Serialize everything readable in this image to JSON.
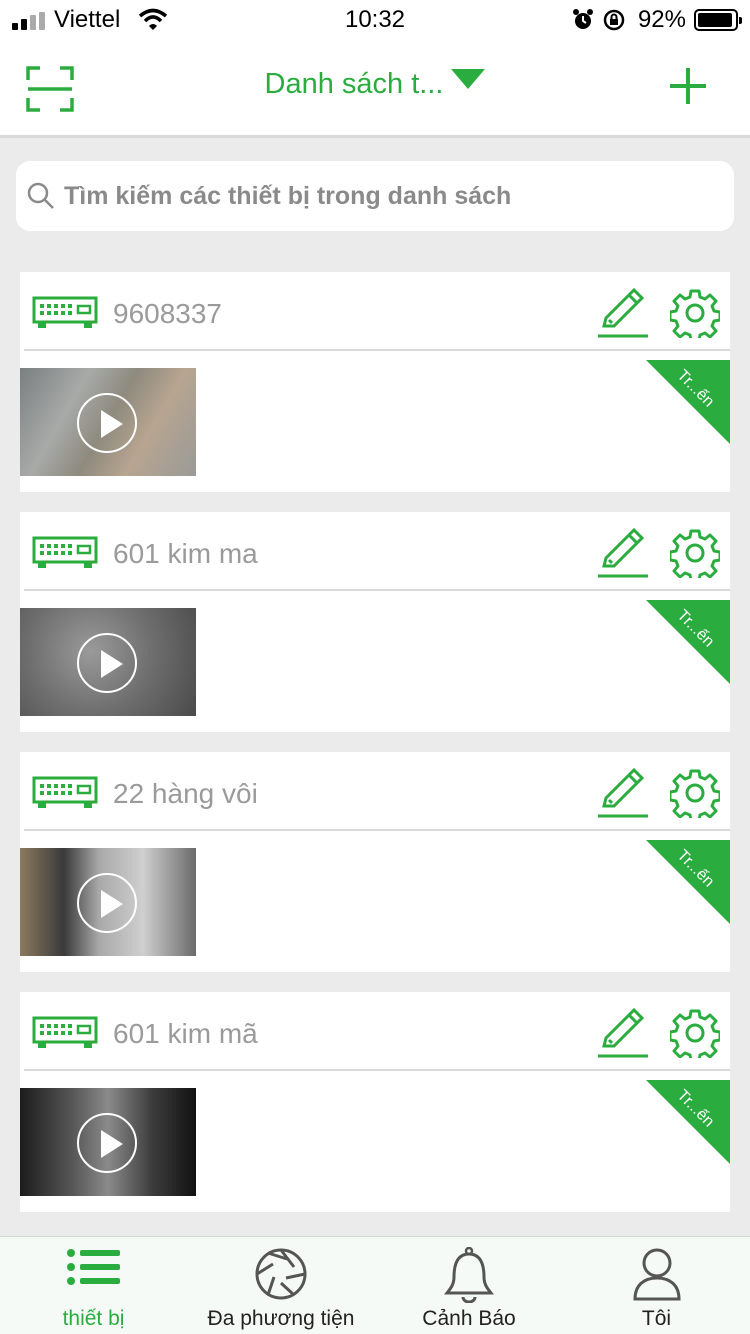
{
  "status": {
    "carrier": "Viettel",
    "time": "10:32",
    "battery": "92%"
  },
  "nav": {
    "title": "Danh sách t...",
    "scan_icon": "scan-icon",
    "add_icon": "plus-icon"
  },
  "search": {
    "placeholder": "Tìm kiếm các thiết bị trong danh sách",
    "value": ""
  },
  "devices": [
    {
      "name": "9608337",
      "status": "Tr...ến"
    },
    {
      "name": "601 kim ma",
      "status": "Tr...ến"
    },
    {
      "name": "22 hàng vôi",
      "status": "Tr...ến"
    },
    {
      "name": "601 kim mã",
      "status": "Tr...ến"
    }
  ],
  "tabs": [
    {
      "label": "thiết bị",
      "icon": "list-icon",
      "active": true
    },
    {
      "label": "Đa phương tiện",
      "icon": "aperture-icon",
      "active": false
    },
    {
      "label": "Cảnh Báo",
      "icon": "bell-icon",
      "active": false
    },
    {
      "label": "Tôi",
      "icon": "user-icon",
      "active": false
    }
  ],
  "colors": {
    "accent": "#2aad3e",
    "background": "#ebebeb",
    "muted_text": "#9a9a9a"
  }
}
